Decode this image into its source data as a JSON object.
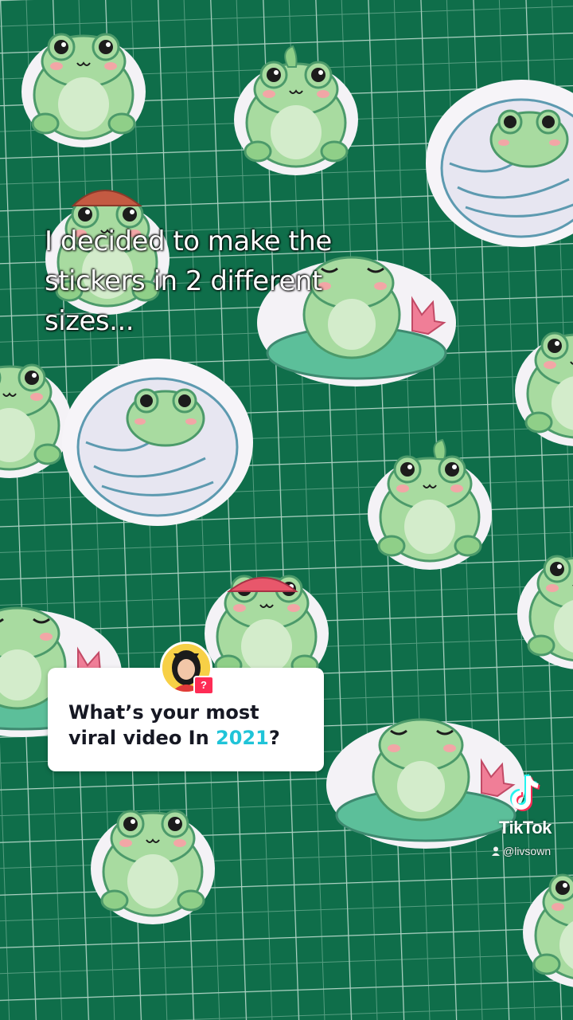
{
  "video": {
    "caption_lines": [
      "I decided to make the",
      "stickers in 2 different",
      "sizes..."
    ]
  },
  "question": {
    "text_before": "What’s your most viral video In ",
    "year": "2021",
    "text_after": "?",
    "badge": "?"
  },
  "watermark": {
    "brand": "TikTok",
    "username": "@livsown",
    "icon": "tiktok-note-icon"
  },
  "colors": {
    "mat": "#0f6e4a",
    "frog": "#a8dba0",
    "accent_year": "#20c4d8",
    "badge": "#fe2c55"
  }
}
